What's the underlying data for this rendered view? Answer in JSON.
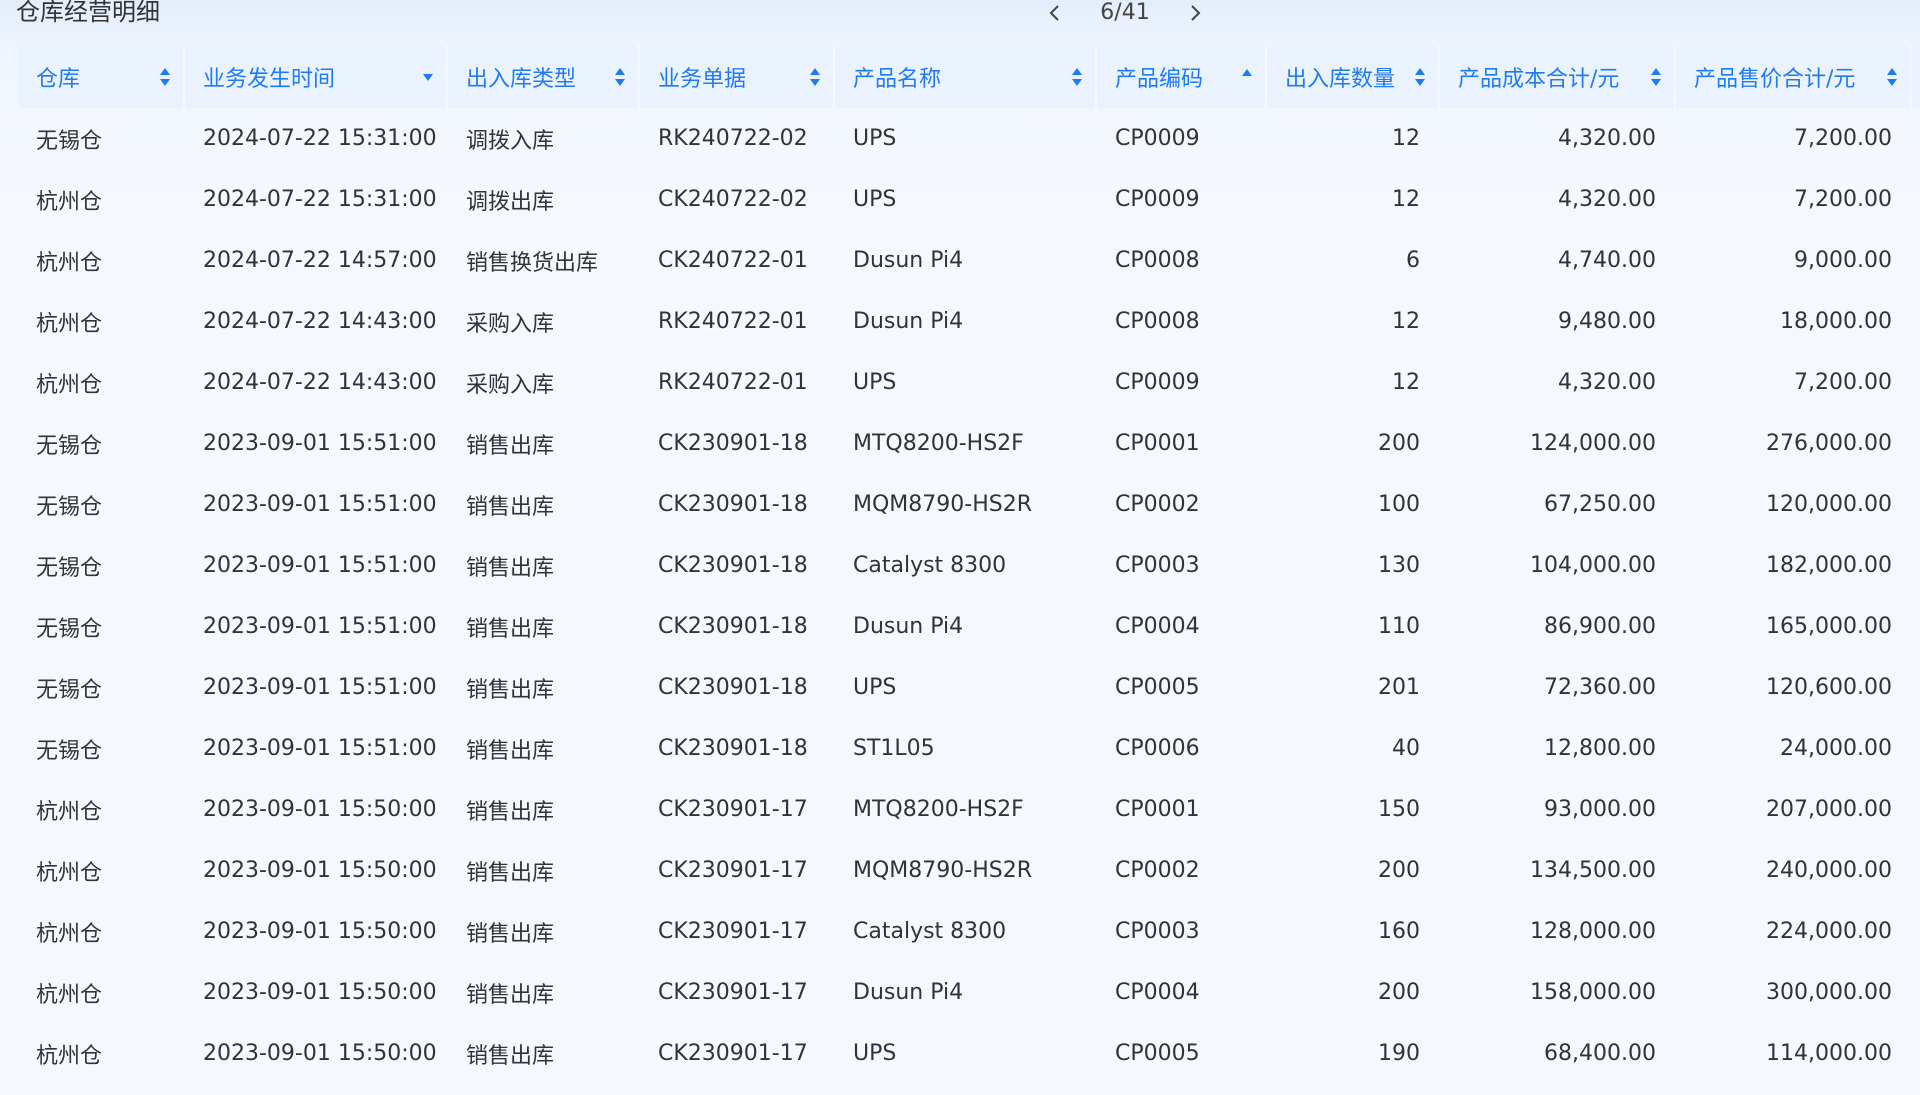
{
  "header": {
    "title": "仓库经营明细",
    "pager_text": "6/41"
  },
  "table": {
    "columns": [
      {
        "label": "仓库",
        "sort": "both"
      },
      {
        "label": "业务发生时间",
        "sort": "desc"
      },
      {
        "label": "出入库类型",
        "sort": "both"
      },
      {
        "label": "业务单据",
        "sort": "both"
      },
      {
        "label": "产品名称",
        "sort": "both"
      },
      {
        "label": "产品编码",
        "sort": "asc"
      },
      {
        "label": "出入库数量",
        "sort": "both"
      },
      {
        "label": "产品成本合计/元",
        "sort": "both"
      },
      {
        "label": "产品售价合计/元",
        "sort": "both"
      }
    ],
    "rows": [
      [
        "无锡仓",
        "2024-07-22 15:31:00",
        "调拨入库",
        "RK240722-02",
        "UPS",
        "CP0009",
        "12",
        "4,320.00",
        "7,200.00"
      ],
      [
        "杭州仓",
        "2024-07-22 15:31:00",
        "调拨出库",
        "CK240722-02",
        "UPS",
        "CP0009",
        "12",
        "4,320.00",
        "7,200.00"
      ],
      [
        "杭州仓",
        "2024-07-22 14:57:00",
        "销售换货出库",
        "CK240722-01",
        "Dusun Pi4",
        "CP0008",
        "6",
        "4,740.00",
        "9,000.00"
      ],
      [
        "杭州仓",
        "2024-07-22 14:43:00",
        "采购入库",
        "RK240722-01",
        "Dusun Pi4",
        "CP0008",
        "12",
        "9,480.00",
        "18,000.00"
      ],
      [
        "杭州仓",
        "2024-07-22 14:43:00",
        "采购入库",
        "RK240722-01",
        "UPS",
        "CP0009",
        "12",
        "4,320.00",
        "7,200.00"
      ],
      [
        "无锡仓",
        "2023-09-01 15:51:00",
        "销售出库",
        "CK230901-18",
        "MTQ8200-HS2F",
        "CP0001",
        "200",
        "124,000.00",
        "276,000.00"
      ],
      [
        "无锡仓",
        "2023-09-01 15:51:00",
        "销售出库",
        "CK230901-18",
        "MQM8790-HS2R",
        "CP0002",
        "100",
        "67,250.00",
        "120,000.00"
      ],
      [
        "无锡仓",
        "2023-09-01 15:51:00",
        "销售出库",
        "CK230901-18",
        "Catalyst 8300",
        "CP0003",
        "130",
        "104,000.00",
        "182,000.00"
      ],
      [
        "无锡仓",
        "2023-09-01 15:51:00",
        "销售出库",
        "CK230901-18",
        "Dusun Pi4",
        "CP0004",
        "110",
        "86,900.00",
        "165,000.00"
      ],
      [
        "无锡仓",
        "2023-09-01 15:51:00",
        "销售出库",
        "CK230901-18",
        "UPS",
        "CP0005",
        "201",
        "72,360.00",
        "120,600.00"
      ],
      [
        "无锡仓",
        "2023-09-01 15:51:00",
        "销售出库",
        "CK230901-18",
        "ST1L05",
        "CP0006",
        "40",
        "12,800.00",
        "24,000.00"
      ],
      [
        "杭州仓",
        "2023-09-01 15:50:00",
        "销售出库",
        "CK230901-17",
        "MTQ8200-HS2F",
        "CP0001",
        "150",
        "93,000.00",
        "207,000.00"
      ],
      [
        "杭州仓",
        "2023-09-01 15:50:00",
        "销售出库",
        "CK230901-17",
        "MQM8790-HS2R",
        "CP0002",
        "200",
        "134,500.00",
        "240,000.00"
      ],
      [
        "杭州仓",
        "2023-09-01 15:50:00",
        "销售出库",
        "CK230901-17",
        "Catalyst 8300",
        "CP0003",
        "160",
        "128,000.00",
        "224,000.00"
      ],
      [
        "杭州仓",
        "2023-09-01 15:50:00",
        "销售出库",
        "CK230901-17",
        "Dusun Pi4",
        "CP0004",
        "200",
        "158,000.00",
        "300,000.00"
      ],
      [
        "杭州仓",
        "2023-09-01 15:50:00",
        "销售出库",
        "CK230901-17",
        "UPS",
        "CP0005",
        "190",
        "68,400.00",
        "114,000.00"
      ]
    ]
  },
  "colors": {
    "accent": "#1f7cf0",
    "header_bg": "#eaf2fd",
    "text": "#333333"
  }
}
